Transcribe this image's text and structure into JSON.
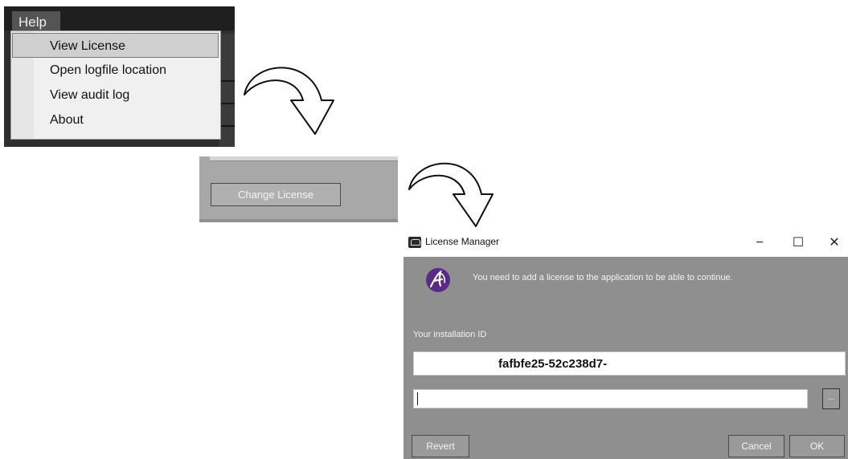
{
  "help_menu": {
    "menu_title": "Help",
    "items": [
      {
        "label": "View License",
        "highlighted": true
      },
      {
        "label": "Open logfile location",
        "highlighted": false
      },
      {
        "label": "View audit log",
        "highlighted": false
      },
      {
        "label": "About",
        "highlighted": false
      }
    ]
  },
  "license_panel": {
    "change_license_label": "Change License"
  },
  "license_manager": {
    "window_title": "License Manager",
    "controls": {
      "minimize": "−",
      "maximize": "☐",
      "close": "✕"
    },
    "message": "You need to add a license to the application to be able to continue.",
    "installation_id_label": "Your installation ID",
    "installation_id_value": "fafbfe25-52c238d7-",
    "license_input_value": "",
    "browse_label": "...",
    "revert_label": "Revert",
    "cancel_label": "Cancel",
    "ok_label": "OK",
    "logo_icon": "alcatel-lucent-logo-icon",
    "colors": {
      "logo": "#5b2a86",
      "dialog_body": "#8f8f8f"
    }
  }
}
